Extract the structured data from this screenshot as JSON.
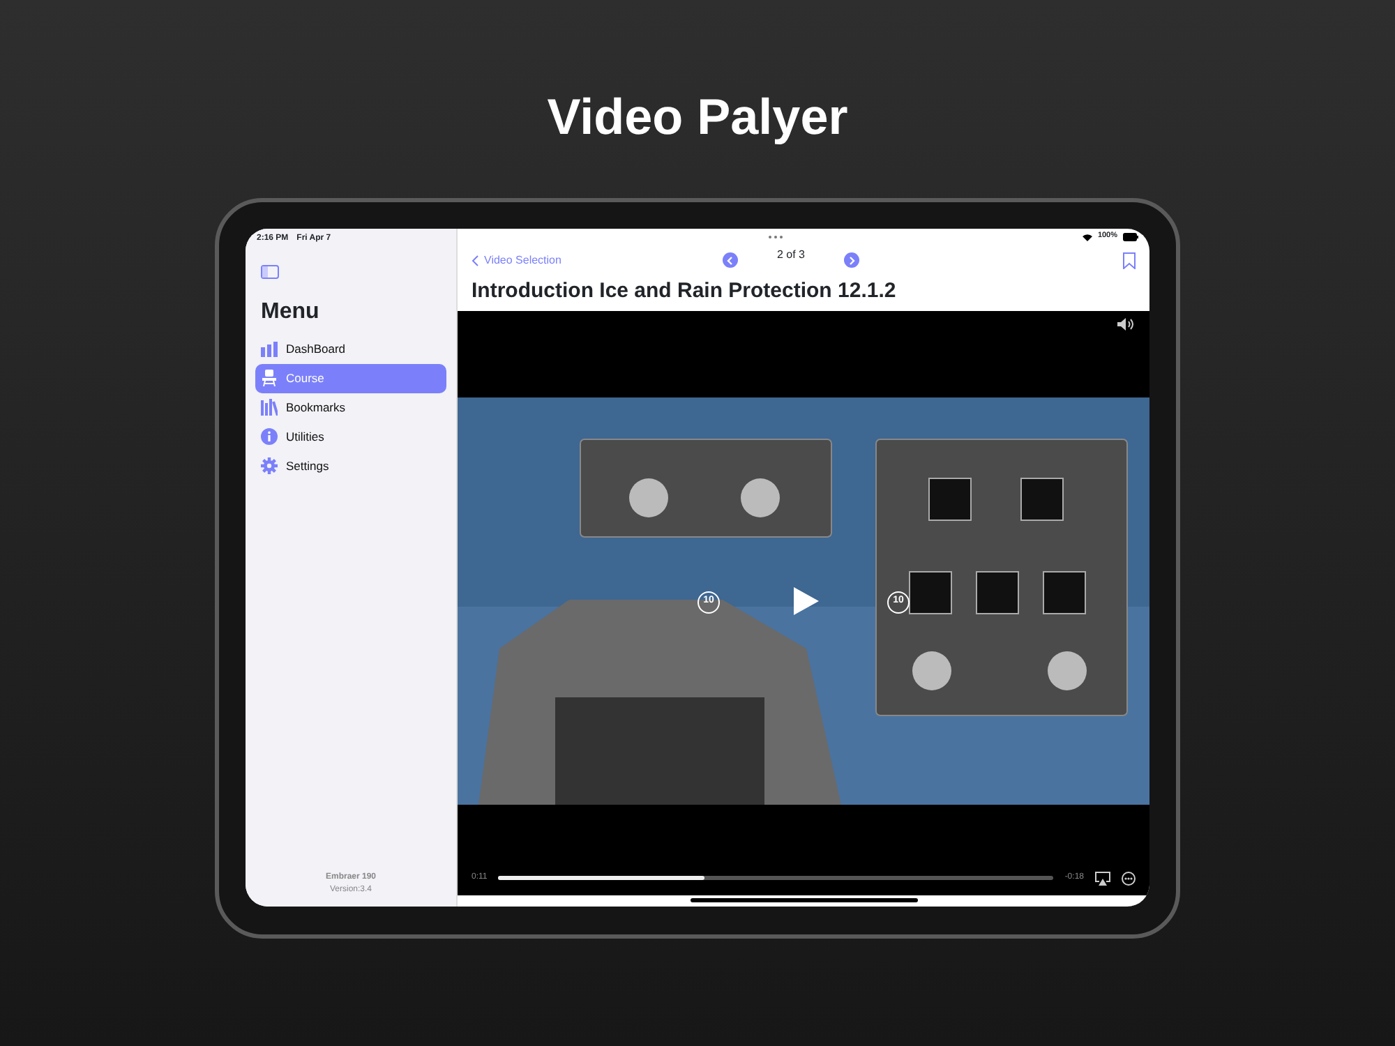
{
  "page_title": "Video Palyer",
  "status_bar": {
    "time": "2:16 PM",
    "date": "Fri Apr 7",
    "battery": "100%"
  },
  "sidebar": {
    "title": "Menu",
    "items": [
      {
        "label": "DashBoard",
        "kind": "chart",
        "selected": false
      },
      {
        "label": "Course",
        "kind": "seat",
        "selected": true
      },
      {
        "label": "Bookmarks",
        "kind": "books",
        "selected": false
      },
      {
        "label": "Utilities",
        "kind": "info",
        "selected": false
      },
      {
        "label": "Settings",
        "kind": "gear",
        "selected": false
      }
    ],
    "footer": {
      "app": "Embraer 190",
      "version": "Version:3.4"
    }
  },
  "nav": {
    "back": "Video Selection",
    "pager": "2 of 3"
  },
  "title": "Introduction Ice and Rain Protection 12.1.2",
  "player": {
    "skip_buttons": [
      {
        "label": "10"
      },
      {
        "label": "10"
      }
    ],
    "elapsed": "0:11",
    "remaining": "-0:18",
    "level": 0.37
  }
}
